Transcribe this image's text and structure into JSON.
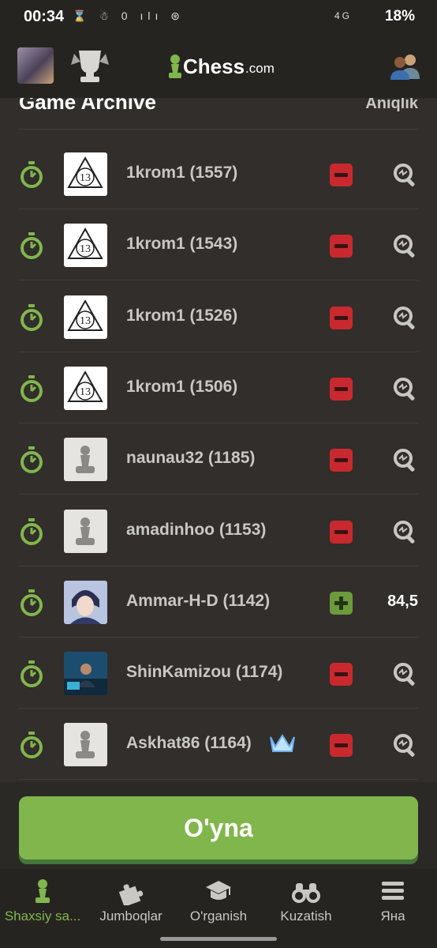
{
  "status": {
    "time": "00:34",
    "icons": "⌛ ☃ 0 ılı ⊛",
    "net_label": "4G",
    "battery": "18%"
  },
  "appbar": {
    "logo_text": "Chess",
    "logo_suffix": ".com"
  },
  "archive": {
    "title": "Game Archive",
    "accuracy_header": "Aniqlik"
  },
  "games": [
    {
      "player": "1krom1 (1557)",
      "result": "loss",
      "avatar": "logo13"
    },
    {
      "player": "1krom1 (1543)",
      "result": "loss",
      "avatar": "logo13"
    },
    {
      "player": "1krom1 (1526)",
      "result": "loss",
      "avatar": "logo13"
    },
    {
      "player": "1krom1 (1506)",
      "result": "loss",
      "avatar": "logo13"
    },
    {
      "player": "naunau32 (1185)",
      "result": "loss",
      "avatar": "pawn"
    },
    {
      "player": "amadinhoo (1153)",
      "result": "loss",
      "avatar": "pawn"
    },
    {
      "player": "Ammar-H-D (1142)",
      "result": "win",
      "avatar": "anime",
      "accuracy": "84,5"
    },
    {
      "player": "ShinKamizou (1174)",
      "result": "loss",
      "avatar": "desk"
    },
    {
      "player": "Askhat86 (1164)",
      "result": "loss",
      "avatar": "pawn",
      "crown": true
    }
  ],
  "play_button": "O'yna",
  "nav": {
    "items": [
      {
        "label": "Shaxsiy sa...",
        "icon": "pawn-icon"
      },
      {
        "label": "Jumboqlar",
        "icon": "puzzle-icon"
      },
      {
        "label": "O'rganish",
        "icon": "graduation-cap-icon"
      },
      {
        "label": "Kuzatish",
        "icon": "binoculars-icon"
      },
      {
        "label": "Яна",
        "icon": "menu-icon"
      }
    ]
  },
  "colors": {
    "accent": "#81b64c",
    "loss": "#c9292e",
    "background": "#312e2b"
  }
}
